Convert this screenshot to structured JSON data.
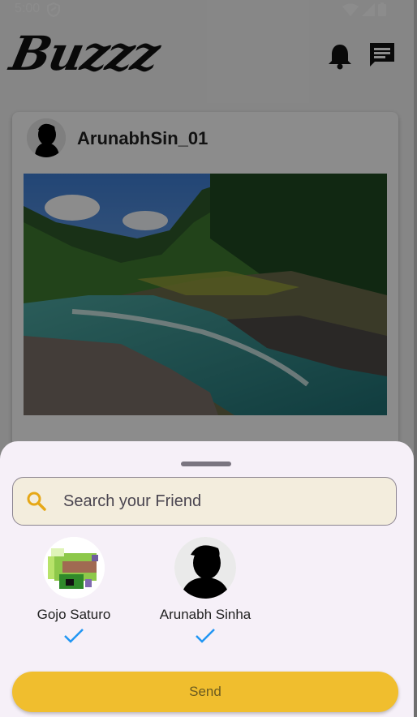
{
  "status": {
    "time": "5:00"
  },
  "app": {
    "logo": "Buzzz"
  },
  "post": {
    "username": "ArunabhSin_01"
  },
  "sheet": {
    "search": {
      "placeholder": "Search your Friend",
      "value": ""
    },
    "friends": [
      {
        "name": "Gojo Saturo",
        "selected": true
      },
      {
        "name": "Arunabh Sinha",
        "selected": true
      }
    ],
    "send_label": "Send"
  },
  "colors": {
    "accent": "#f0be2e",
    "check": "#2196f3",
    "sheet_bg": "#f6f0f8"
  }
}
